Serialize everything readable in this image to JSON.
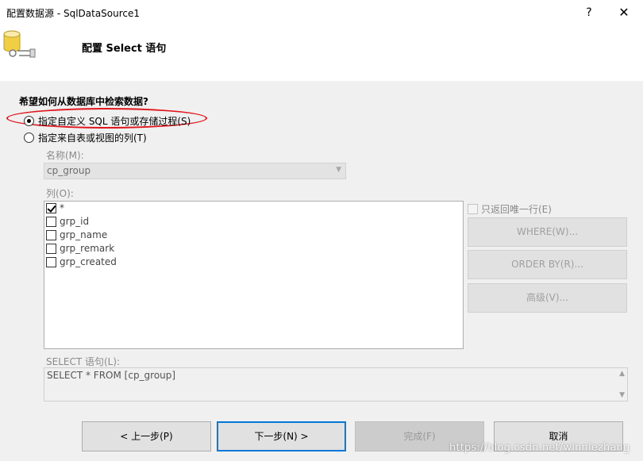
{
  "window": {
    "title": "配置数据源 - SqlDataSource1",
    "help_label": "?",
    "close_label": "✕"
  },
  "header": {
    "title": "配置 Select 语句",
    "icon": "database-icon"
  },
  "form": {
    "question": "希望如何从数据库中检索数据?",
    "radio_custom_sql": "指定自定义 SQL 语句或存储过程(S)",
    "radio_table_columns": "指定来自表或视图的列(T)",
    "name_label": "名称(M):",
    "name_value": "cp_group",
    "columns_label": "列(O):",
    "columns": [
      {
        "label": "*",
        "checked": true
      },
      {
        "label": "grp_id",
        "checked": false
      },
      {
        "label": "grp_name",
        "checked": false
      },
      {
        "label": "grp_remark",
        "checked": false
      },
      {
        "label": "grp_created",
        "checked": false
      }
    ],
    "distinct_label": "只返回唯一行(E)",
    "where_button": "WHERE(W)...",
    "orderby_button": "ORDER BY(R)...",
    "advanced_button": "高级(V)...",
    "select_label": "SELECT 语句(L):",
    "select_value": "SELECT * FROM [cp_group]"
  },
  "footer": {
    "prev_button": "< 上一步(P)",
    "next_button": "下一步(N) >",
    "finish_button": "完成(F)",
    "cancel_button": "取消",
    "watermark": "https://blog.csdn.net/winniezhang"
  },
  "colors": {
    "highlight": "#e0161e",
    "primary_border": "#0078d7",
    "panel_bg": "#f0f0f0"
  }
}
